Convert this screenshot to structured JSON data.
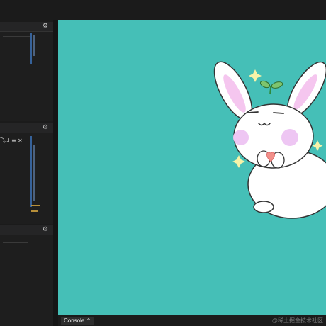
{
  "panels": [
    {
      "settings_icon": "gear-icon"
    },
    {
      "settings_icon": "gear-icon",
      "toolbar_icons": [
        "step-over-icon",
        "step-into-icon",
        "step-out-icon",
        "close-icon"
      ]
    },
    {
      "settings_icon": "gear-icon"
    }
  ],
  "bottom_bar": {
    "console_label": "Console ⌃",
    "watermark": "@稀土掘金技术社区"
  },
  "stage": {
    "background": "#45bfb7",
    "illustration": "bunny-with-heart"
  }
}
